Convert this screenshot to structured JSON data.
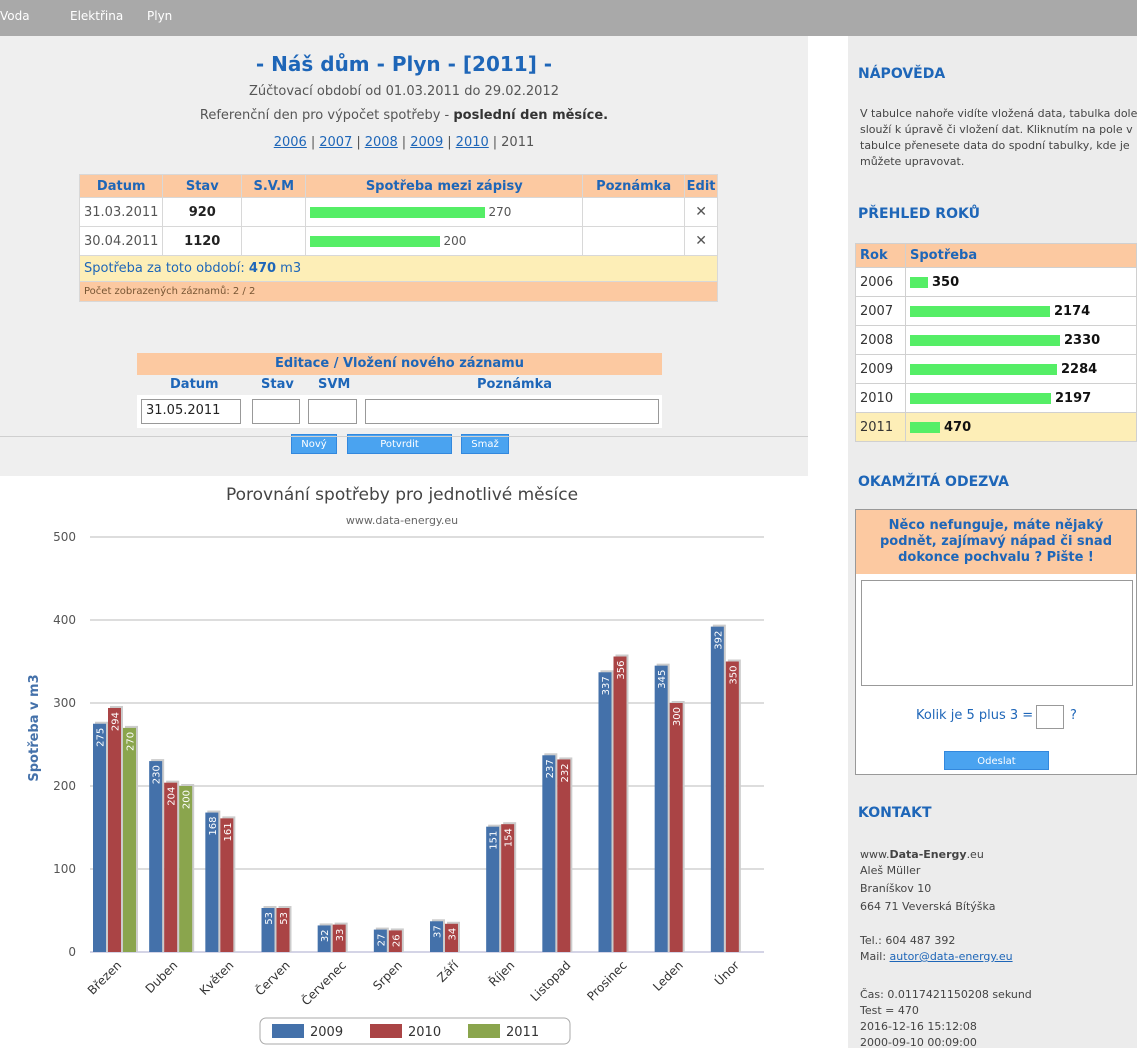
{
  "nav": {
    "items": [
      "Voda",
      "Elektřina",
      "Plyn"
    ]
  },
  "header": {
    "title": "- Náš dům - Plyn - [2011] -",
    "period": "Zúčtovací období od 01.03.2011 do 29.02.2012",
    "refday_prefix": "Referenční den pro výpočet spotřeby - ",
    "refday_value": "poslední den měsíce.",
    "years": [
      "2006",
      "2007",
      "2008",
      "2009",
      "2010"
    ],
    "current_year": "2011"
  },
  "records": {
    "headers": [
      "Datum",
      "Stav",
      "S.V.M",
      "Spotřeba mezi zápisy",
      "Poznámka",
      "Edit"
    ],
    "rows": [
      {
        "datum": "31.03.2011",
        "stav": "920",
        "svm": "",
        "spotreba": "270",
        "fraction": 0.648,
        "poznamka": "",
        "edit": "✕"
      },
      {
        "datum": "30.04.2011",
        "stav": "1120",
        "svm": "",
        "spotreba": "200",
        "fraction": 0.48,
        "poznamka": "",
        "edit": "✕"
      }
    ],
    "sum_label": "Spotřeba za toto období: ",
    "sum_value": "470",
    "sum_unit": " m3",
    "count_text": "Počet zobrazených záznamů: 2 / 2"
  },
  "edit_form": {
    "title": "Editace / Vložení nového záznamu",
    "labels": {
      "datum": "Datum",
      "stav": "Stav",
      "svm": "SVM",
      "poznamka": "Poznámka"
    },
    "datum_value": "31.05.2011",
    "buttons": {
      "new": "Nový",
      "confirm": "Potvrdit",
      "delete": "Smaž"
    }
  },
  "chart_data": {
    "type": "bar",
    "title": "Porovnání spotřeby pro jednotlivé měsíce",
    "subtitle": "www.data-energy.eu",
    "ylabel": "Spotřeba v m3",
    "ylim": [
      0,
      500
    ],
    "yticks": [
      "0",
      "100",
      "200",
      "300",
      "400",
      "500"
    ],
    "categories": [
      "Březen",
      "Duben",
      "Květen",
      "Červen",
      "Červenec",
      "Srpen",
      "Září",
      "Říjen",
      "Listopad",
      "Prosinec",
      "Leden",
      "Únor"
    ],
    "series": [
      {
        "name": "2009",
        "color": "#4471aa",
        "values": [
          275,
          230,
          168,
          53,
          32,
          27,
          37,
          151,
          237,
          337,
          345,
          392
        ]
      },
      {
        "name": "2010",
        "color": "#aa4445",
        "values": [
          294,
          204,
          161,
          53,
          33,
          26,
          34,
          154,
          232,
          356,
          300,
          350
        ]
      },
      {
        "name": "2011",
        "color": "#8aa54d",
        "values": [
          270,
          200,
          null,
          null,
          null,
          null,
          null,
          null,
          null,
          null,
          null,
          null
        ]
      }
    ],
    "legend": "bottom",
    "grid": true
  },
  "sidebar": {
    "help_title": "NÁPOVĚDA",
    "help_text": "V tabulce nahoře vidíte vložená data, tabulka dole slouží k úpravě či vložení dat. Kliknutím na pole v tabulce přenesete data do spodní tabulky, kde je můžete upravovat.",
    "years_title": "PŘEHLED ROKŮ",
    "years_headers": [
      "Rok",
      "Spotřeba"
    ],
    "years_rows": [
      {
        "rok": "2006",
        "spotreba": "350",
        "fraction": 0.12
      },
      {
        "rok": "2007",
        "spotreba": "2174",
        "fraction": 0.93
      },
      {
        "rok": "2008",
        "spotreba": "2330",
        "fraction": 1.0
      },
      {
        "rok": "2009",
        "spotreba": "2284",
        "fraction": 0.98
      },
      {
        "rok": "2010",
        "spotreba": "2197",
        "fraction": 0.94
      },
      {
        "rok": "2011",
        "spotreba": "470",
        "fraction": 0.2
      }
    ],
    "feedback_title": "OKAMŽITÁ ODEZVA",
    "feedback_prompt": "Něco nefunguje, máte nějaký podnět, zajímavý nápad či snad dokonce pochvalu ? Pište !",
    "captcha_text": "Kolik je 5 plus 3 =",
    "captcha_q": "?",
    "send_label": "Odeslat",
    "contact_title": "KONTAKT",
    "contact_web_prefix": "www.",
    "contact_web_bold": "Data-Energy",
    "contact_web_suffix": ".eu",
    "contact_name": "Aleš Müller",
    "contact_street": "Braníškov 10",
    "contact_city": "664 71 Veverská Bítýška",
    "contact_tel": "Tel.: 604 487 392",
    "contact_mail_label": "Mail: ",
    "contact_mail": "autor@data-energy.eu",
    "footer_lines": [
      "Čas: 0.0117421150208 sekund",
      "Test = 470",
      "2016-12-16 15:12:08",
      "2000-09-10 00:09:00"
    ]
  }
}
